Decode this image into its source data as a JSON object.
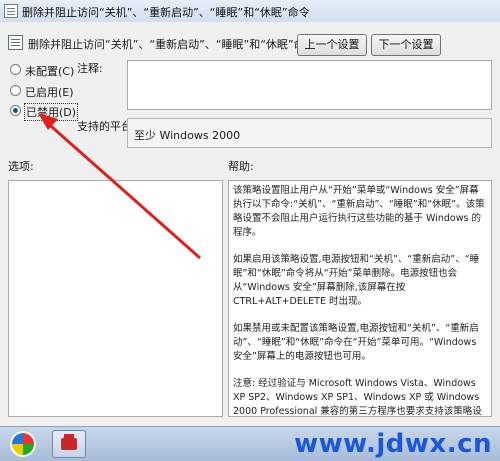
{
  "window": {
    "title": "删除并阻止访问“关机”、“重新启动”、“睡眠”和“休眠”命令",
    "icon": "policy-icon"
  },
  "header": {
    "policy_title": "删除并阻止访问“关机”、“重新启动”、“睡眠”和“休眠”命令",
    "prev_button": "上一个设置(P)",
    "next_button": "下一个设置(N)"
  },
  "state": {
    "options": [
      {
        "label": "未配置(C)",
        "selected": false
      },
      {
        "label": "已启用(E)",
        "selected": false
      },
      {
        "label": "已禁用(D)",
        "selected": true
      }
    ]
  },
  "labels": {
    "comment": "注释:",
    "supported_on": "支持的平台:",
    "options": "选项:",
    "help": "帮助:"
  },
  "comment_value": "",
  "supported_platform": "至少 Windows 2000",
  "help_paragraphs": [
    "该策略设置阻止用户从“开始”菜单或“Windows 安全”屏幕执行以下命令:“关机”、“重新启动”、“睡眠”和“休眠”。该策略设置不会阻止用户运行执行这些功能的基于 Windows 的程序。",
    "如果启用该策略设置,电源按钮和“关机”、“重新启动”、“睡眠”和“休眠”命令将从“开始”菜单删除。电源按钮也会从“Windows 安全”屏幕删除,该屏幕在按 CTRL+ALT+DELETE 时出现。",
    "如果禁用或未配置该策略设置,电源按钮和“关机”、“重新启动”、“睡眠”和“休眠”命令在“开始”菜单可用。“Windows 安全”屏幕上的电源按钮也可用。",
    "注意: 经过验证与 Microsoft Windows Vista、Windows XP SP2、Windows XP SP1、Windows XP 或 Windows 2000 Professional 兼容的第三方程序也要求支持该策略设置。"
  ],
  "taskbar": {
    "start_icon": "start-orb-icon",
    "task_icon": "toolbox-icon",
    "watermark": "www.jdwx.cn"
  },
  "annotation": {
    "arrow_color": "#e0201b"
  }
}
